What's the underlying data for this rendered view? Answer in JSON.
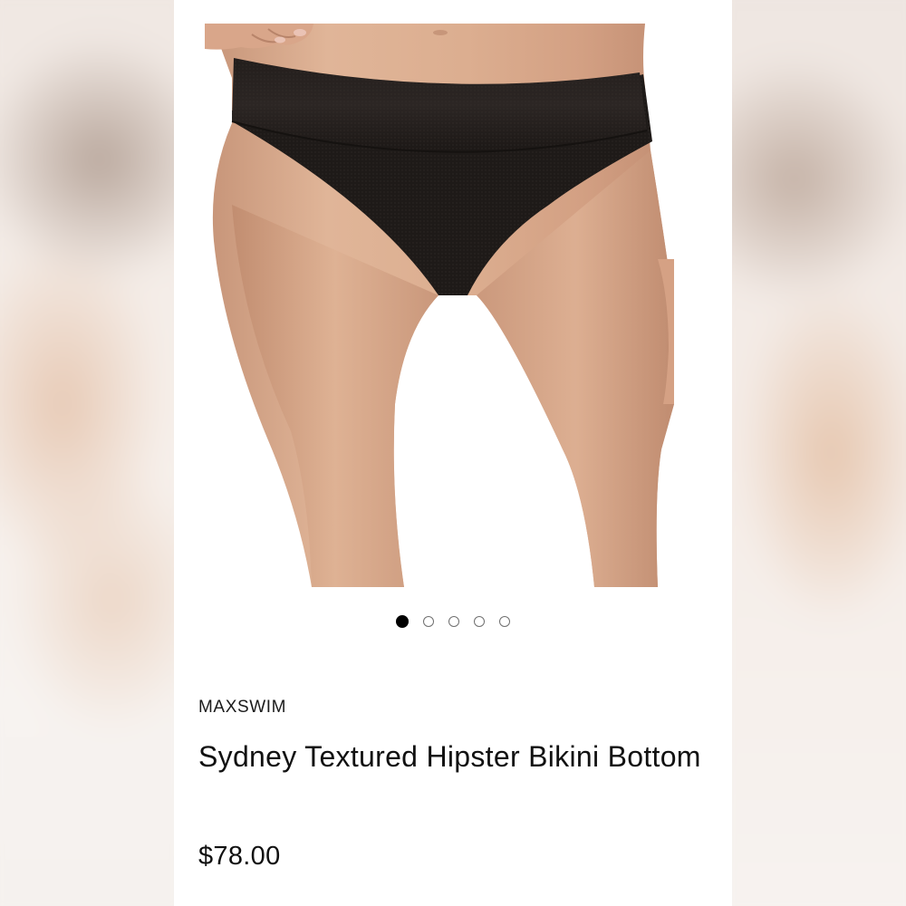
{
  "product": {
    "brand": "MAXSWIM",
    "title": "Sydney Textured Hipster Bikini Bottom",
    "price": "$78.00"
  },
  "gallery": {
    "image_count": 5,
    "active_index": 0,
    "product_color": "#1e1a18",
    "skin_color": "#d8ab8d"
  }
}
